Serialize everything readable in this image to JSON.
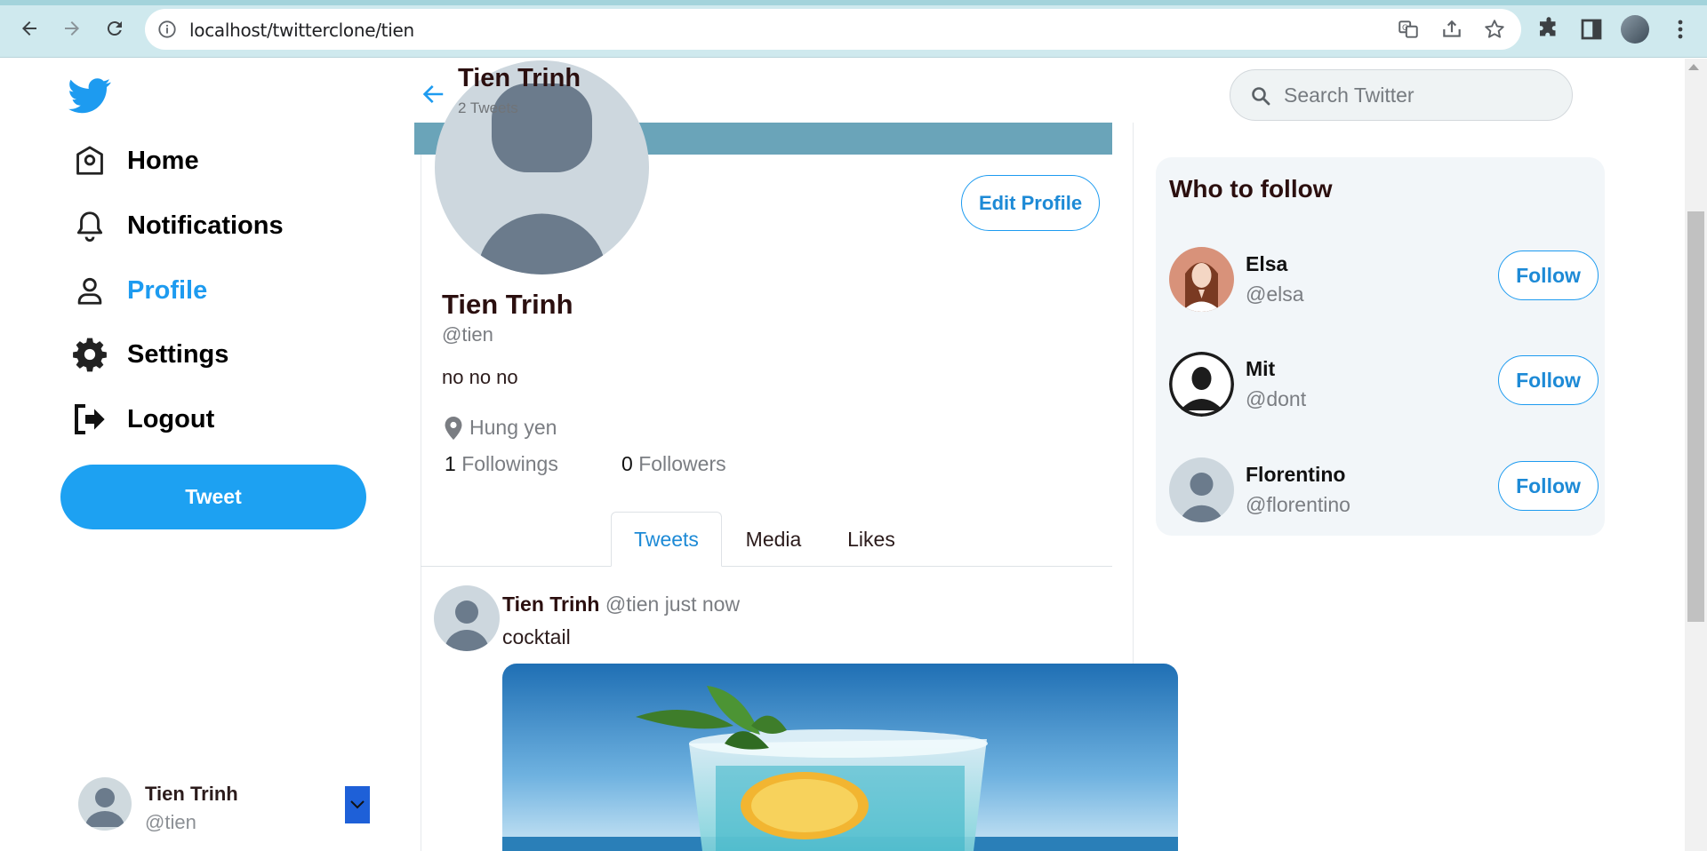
{
  "browser": {
    "url": "localhost/twitterclone/tien"
  },
  "sidebar": {
    "items": [
      {
        "label": "Home",
        "icon": "home-icon"
      },
      {
        "label": "Notifications",
        "icon": "bell-icon"
      },
      {
        "label": "Profile",
        "icon": "user-icon"
      },
      {
        "label": "Settings",
        "icon": "gear-icon"
      },
      {
        "label": "Logout",
        "icon": "logout-icon"
      }
    ],
    "tweet_label": "Tweet",
    "account": {
      "name": "Tien Trinh",
      "handle": "@tien"
    }
  },
  "header": {
    "title": "Tien Trinh",
    "subtitle": "2 Tweets"
  },
  "profile": {
    "edit_label": "Edit Profile",
    "name": "Tien Trinh",
    "handle": "@tien",
    "bio": "no no no",
    "location": "Hung yen",
    "followings_count": "1",
    "followings_label": "Followings",
    "followers_count": "0",
    "followers_label": "Followers"
  },
  "tabs": [
    {
      "label": "Tweets",
      "active": true
    },
    {
      "label": "Media",
      "active": false
    },
    {
      "label": "Likes",
      "active": false
    }
  ],
  "tweet": {
    "name": "Tien Trinh",
    "meta": "@tien just now",
    "text": "cocktail"
  },
  "search": {
    "placeholder": "Search Twitter"
  },
  "who_to_follow": {
    "title": "Who to follow",
    "follow_label": "Follow",
    "users": [
      {
        "name": "Elsa",
        "handle": "@elsa"
      },
      {
        "name": "Mit",
        "handle": "@dont"
      },
      {
        "name": "Florentino",
        "handle": "@florentino"
      }
    ]
  },
  "colors": {
    "accent": "#1d9bf0",
    "banner": "#6aa4b9",
    "dropdown": "#1e60d8"
  }
}
